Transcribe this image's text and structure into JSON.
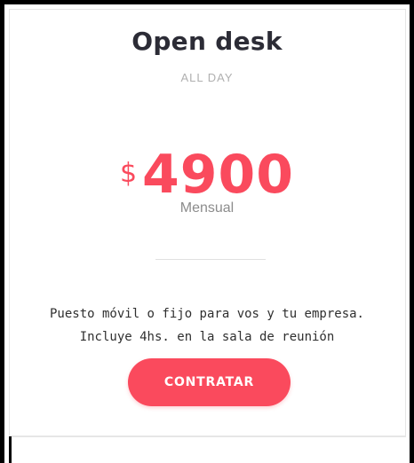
{
  "plan": {
    "name": "Open desk",
    "subtitle": "ALL DAY",
    "currency_symbol": "$",
    "price": "4900",
    "period": "Mensual",
    "description_line1": "Puesto móvil o fijo para vos y tu empresa.",
    "description_line2": "Incluye 4hs. en la sala de reunión",
    "cta_label": "CONTRATAR"
  },
  "colors": {
    "accent": "#fa4a5d",
    "title": "#2c2c36",
    "muted": "#b0b0b0",
    "text": "#2f2f2f"
  }
}
